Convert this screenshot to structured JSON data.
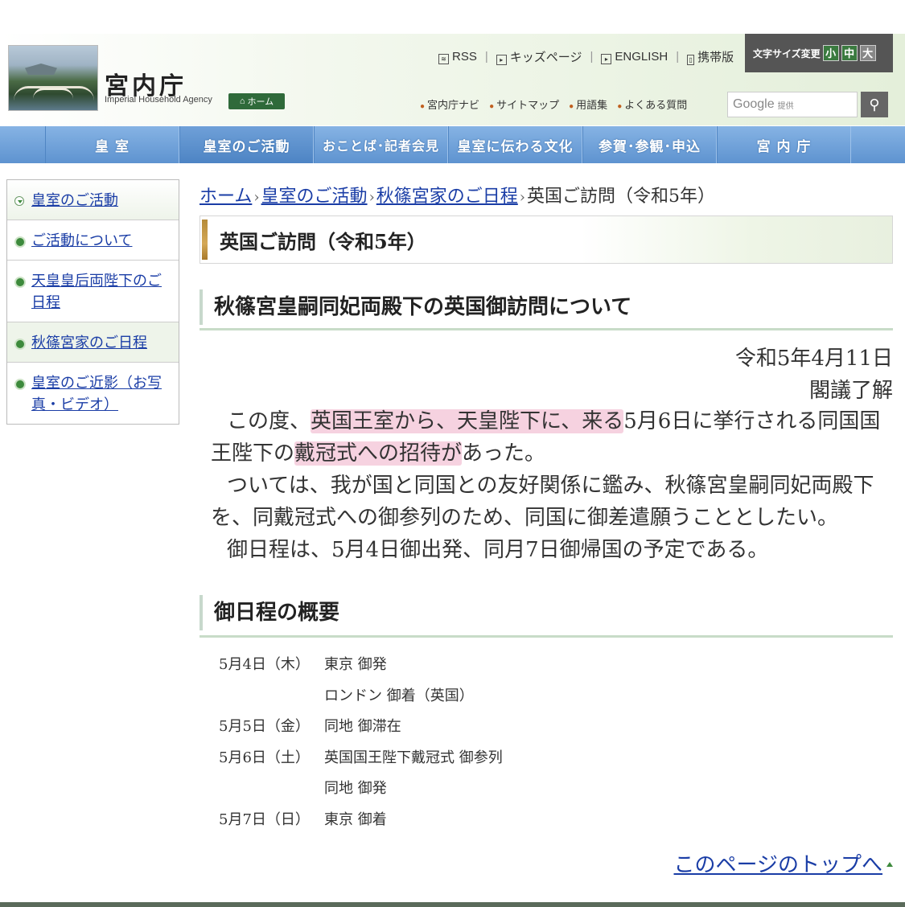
{
  "header": {
    "agency_name_jp": "宮内庁",
    "agency_name_en": "Imperial Household Agency",
    "home_label": "ホーム",
    "top_links": [
      {
        "label": "RSS",
        "icon": "rss-icon"
      },
      {
        "label": "キッズページ",
        "icon": "play-box-icon"
      },
      {
        "label": "ENGLISH",
        "icon": "play-box-icon"
      },
      {
        "label": "携帯版",
        "icon": "mobile-icon"
      }
    ],
    "font_size_label": "文字サイズ変更",
    "font_size_small": "小",
    "font_size_medium": "中",
    "font_size_large": "大",
    "sub_links": [
      "宮内庁ナビ",
      "サイトマップ",
      "用語集",
      "よくある質問"
    ],
    "search_placeholder": "Google",
    "search_provided": "提供"
  },
  "nav": {
    "items": [
      "皇 室",
      "皇室のご活動",
      "おことば･記者会見",
      "皇室に伝わる文化",
      "参賀･参観･申込",
      "宮 内 庁"
    ],
    "active_index": 1
  },
  "sidebar": {
    "items": [
      {
        "label": "皇室のご活動"
      },
      {
        "label": "ご活動について"
      },
      {
        "label": "天皇皇后両陛下のご日程"
      },
      {
        "label": "秋篠宮家のご日程"
      },
      {
        "label": "皇室のご近影（お写真・ビデオ）"
      }
    ]
  },
  "breadcrumb": {
    "items": [
      "ホーム",
      "皇室のご活動",
      "秋篠宮家のご日程"
    ],
    "current": "英国ご訪問（令和5年）"
  },
  "page_title": "英国ご訪問（令和5年）",
  "section1": {
    "title": "秋篠宮皇嗣同妃両殿下の英国御訪問について",
    "date": "令和5年4月11日",
    "decision": "閣議了解",
    "para1_a": "この度、",
    "para1_hl1": "英国王室から、天皇陛下に、来る",
    "para1_b": "5月6日に挙行される同国国王陛下の",
    "para1_hl2": "戴冠式への招待が",
    "para1_c": "あった。",
    "para2": "ついては、我が国と同国との友好関係に鑑み、秋篠宮皇嗣同妃両殿下を、同戴冠式への御参列のため、同国に御差遣願うこととしたい。",
    "para3": "御日程は、5月4日御出発、同月7日御帰国の予定である。"
  },
  "section2": {
    "title": "御日程の概要",
    "schedule": [
      {
        "date": "5月4日（木）",
        "event": "東京 御発"
      },
      {
        "date": "",
        "event": "ロンドン 御着（英国）"
      },
      {
        "date": "5月5日（金）",
        "event": "同地 御滞在"
      },
      {
        "date": "5月6日（土）",
        "event": "英国国王陛下戴冠式 御参列"
      },
      {
        "date": "",
        "event": "同地 御発"
      },
      {
        "date": "5月7日（日）",
        "event": "東京 御着"
      }
    ]
  },
  "to_top_label": "このページのトップへ"
}
